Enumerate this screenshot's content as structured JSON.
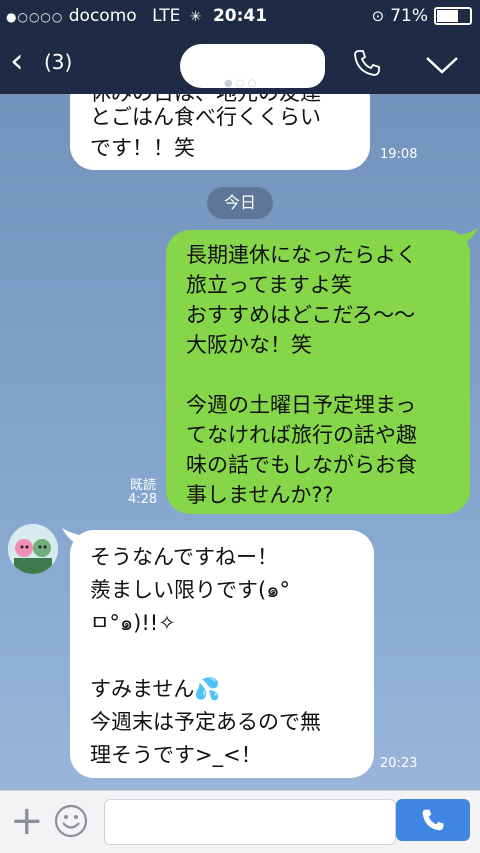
{
  "status": {
    "signal": "●○○○○",
    "carrier": "docomo",
    "network": "LTE",
    "time": "20:41",
    "battery": "71%",
    "battery_level": 0.71
  },
  "header": {
    "back_icon": "‹",
    "unread_count": "(3)"
  },
  "messages": [
    {
      "side": "in",
      "lines": [
        "とごはん食べ行くくらい",
        "です！！笑"
      ],
      "time": "19:08"
    },
    {
      "side": "out",
      "lines": [
        "長期連休になったらよく",
        "旅立ってますよ笑",
        "おすすめはどこだろ〜〜",
        "大阪かな！笑",
        "",
        "今週の土曜日予定埋まっ",
        "てなければ旅行の話や趣",
        "味の話でもしながらお食",
        "事しませんか??"
      ],
      "read": "既読",
      "time": "4:28"
    },
    {
      "side": "in",
      "lines": [
        "そうなんですねー！",
        "羨ましい限りです(๑°",
        "ㅁ°๑)!!✧",
        "",
        "すみません💦",
        "今週末は予定あるので無",
        "理そうです>_<！"
      ],
      "time": "20:23"
    }
  ],
  "date_divider": "今日",
  "partial_top_line": "休みの日は、地元の友達",
  "composer": {
    "placeholder": ""
  },
  "colors": {
    "bar": "#1f2b44",
    "outgoing_bubble": "#86d64a",
    "incoming_bubble": "#ffffff",
    "send_button": "#3f86e0"
  }
}
